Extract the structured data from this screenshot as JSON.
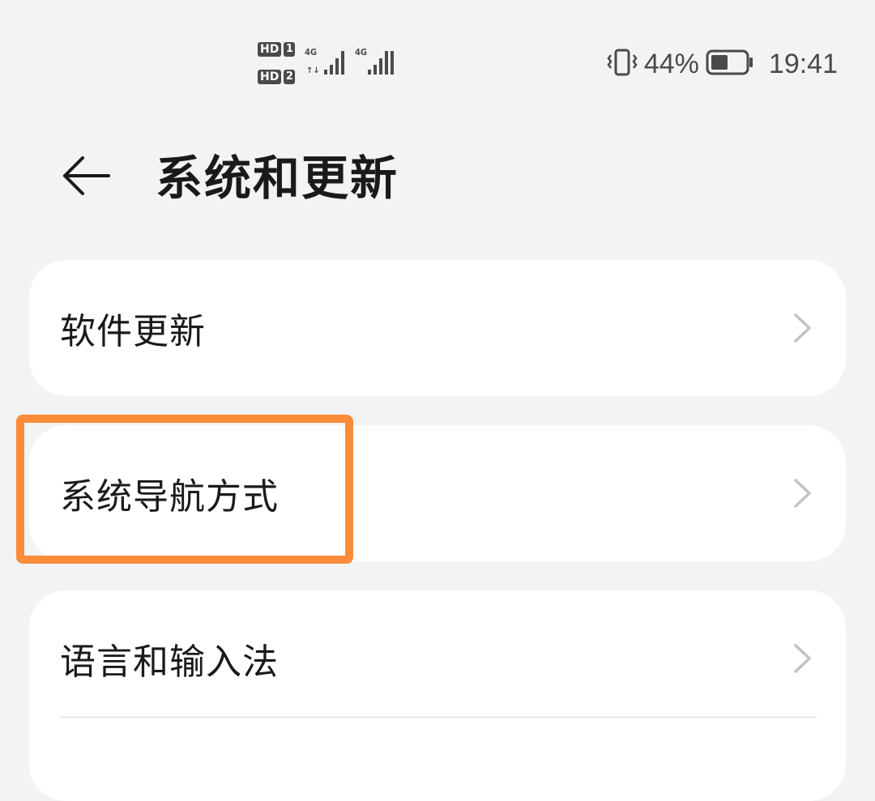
{
  "status_bar": {
    "sim1_hd": "HD",
    "sim1_num": "1",
    "sim2_hd": "HD",
    "sim2_num": "2",
    "sim1_network": "4G",
    "sim2_network": "4G",
    "battery_percent": "44%",
    "time": "19:41",
    "icons": [
      "vibrate-icon",
      "battery-icon",
      "signal-icon"
    ]
  },
  "header": {
    "back_icon": "back-arrow-icon",
    "title": "系统和更新"
  },
  "items": [
    {
      "label": "软件更新",
      "icon": "chevron-right-icon"
    },
    {
      "label": "系统导航方式",
      "icon": "chevron-right-icon"
    },
    {
      "label": "语言和输入法",
      "icon": "chevron-right-icon"
    }
  ],
  "colors": {
    "background": "#f1f3f5",
    "card": "#ffffff",
    "highlight": "#fb8c3a",
    "text": "#1a1a1a",
    "chevron": "#c2c2c2"
  }
}
